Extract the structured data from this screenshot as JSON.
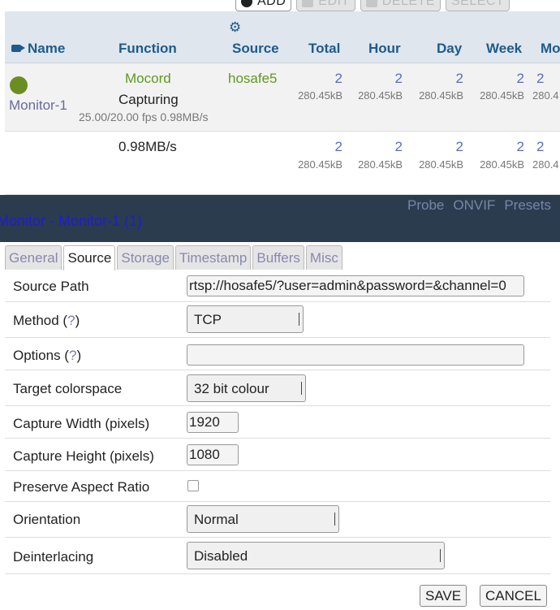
{
  "toolbar": {
    "add": "ADD",
    "edit": "EDIT",
    "delete": "DELETE",
    "select": "SELECT"
  },
  "table": {
    "headers": {
      "name": "Name",
      "function": "Function",
      "source": "Source",
      "total": "Total",
      "hour": "Hour",
      "day": "Day",
      "week": "Week",
      "month": "Mo"
    },
    "monitor_row": {
      "status_color": "#6b8e23",
      "name": "Monitor-1",
      "function": "Mocord",
      "status": "Capturing",
      "stats": "25.00/20.00 fps 0.98MB/s",
      "source": "hosafe5",
      "counts": [
        "2",
        "2",
        "2",
        "2",
        "2"
      ],
      "sizes": [
        "280.45kB",
        "280.45kB",
        "280.45kB",
        "280.45kB",
        "280.4"
      ]
    },
    "totals_row": {
      "bandwidth": "0.98MB/s",
      "counts": [
        "2",
        "2",
        "2",
        "2",
        "2"
      ],
      "sizes": [
        "280.45kB",
        "280.45kB",
        "280.45kB",
        "280.45kB",
        "280.4"
      ]
    }
  },
  "dialog": {
    "title": "Monitor - Monitor-1 (1)",
    "header_links": [
      "Probe",
      "ONVIF",
      "Presets"
    ],
    "tabs": [
      "General",
      "Source",
      "Storage",
      "Timestamp",
      "Buffers",
      "Misc"
    ],
    "active_tab": "Source",
    "fields": {
      "source_path": {
        "label": "Source Path",
        "value": "rtsp://hosafe5/?user=admin&password=&channel=0"
      },
      "method": {
        "label": "Method (",
        "help": "?",
        "close": ")",
        "value": "TCP"
      },
      "options": {
        "label": "Options (",
        "help": "?",
        "close": ")",
        "value": ""
      },
      "colorspace": {
        "label": "Target colorspace",
        "value": "32 bit colour"
      },
      "width": {
        "label": "Capture Width (pixels)",
        "value": "1920"
      },
      "height": {
        "label": "Capture Height (pixels)",
        "value": "1080"
      },
      "aspect": {
        "label": "Preserve Aspect Ratio",
        "checked": false
      },
      "orientation": {
        "label": "Orientation",
        "value": "Normal"
      },
      "deinterlacing": {
        "label": "Deinterlacing",
        "value": "Disabled"
      }
    },
    "save": "SAVE",
    "cancel": "CANCEL"
  }
}
